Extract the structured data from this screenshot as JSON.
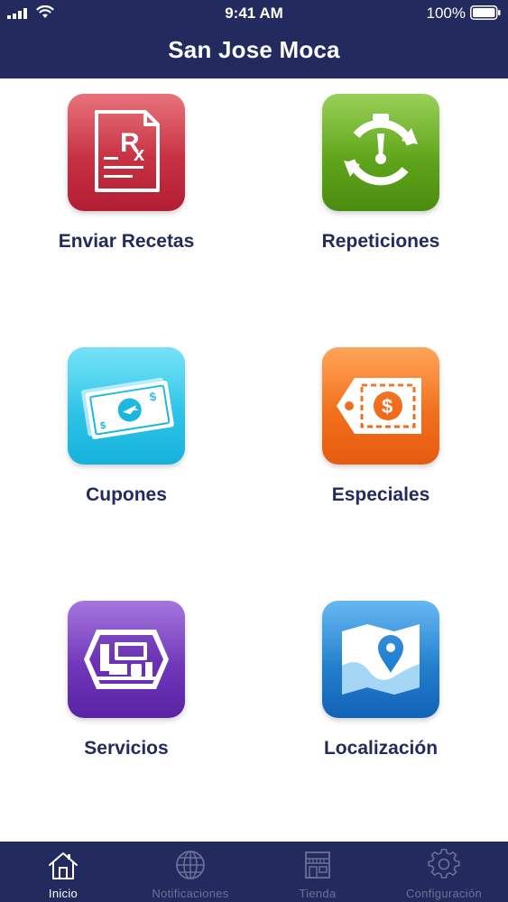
{
  "status_bar": {
    "time": "9:41 AM",
    "battery": "100%"
  },
  "header": {
    "title": "San Jose Moca"
  },
  "menu": {
    "items": [
      {
        "label": "Enviar Recetas",
        "icon": "prescription-icon",
        "color": "#c42a3c"
      },
      {
        "label": "Repeticiones",
        "icon": "refill-timer-icon",
        "color": "#5fa418"
      },
      {
        "label": "Cupones",
        "icon": "coupon-money-icon",
        "color": "#23c6ec"
      },
      {
        "label": "Especiales",
        "icon": "price-tag-icon",
        "color": "#f37020"
      },
      {
        "label": "Servicios",
        "icon": "services-box-icon",
        "color": "#6a2fb5"
      },
      {
        "label": "Localización",
        "icon": "map-pin-icon",
        "color": "#1e7fd1"
      }
    ]
  },
  "tab_bar": {
    "tabs": [
      {
        "label": "Inicio",
        "icon": "home-icon",
        "active": true
      },
      {
        "label": "Notificaciones",
        "icon": "globe-icon",
        "active": false
      },
      {
        "label": "Tienda",
        "icon": "store-icon",
        "active": false
      },
      {
        "label": "Configuración",
        "icon": "gear-icon",
        "active": false
      }
    ]
  },
  "colors": {
    "header_bg": "#232b5e",
    "label_text": "#232b5e",
    "tab_inactive": "#6a7196"
  }
}
